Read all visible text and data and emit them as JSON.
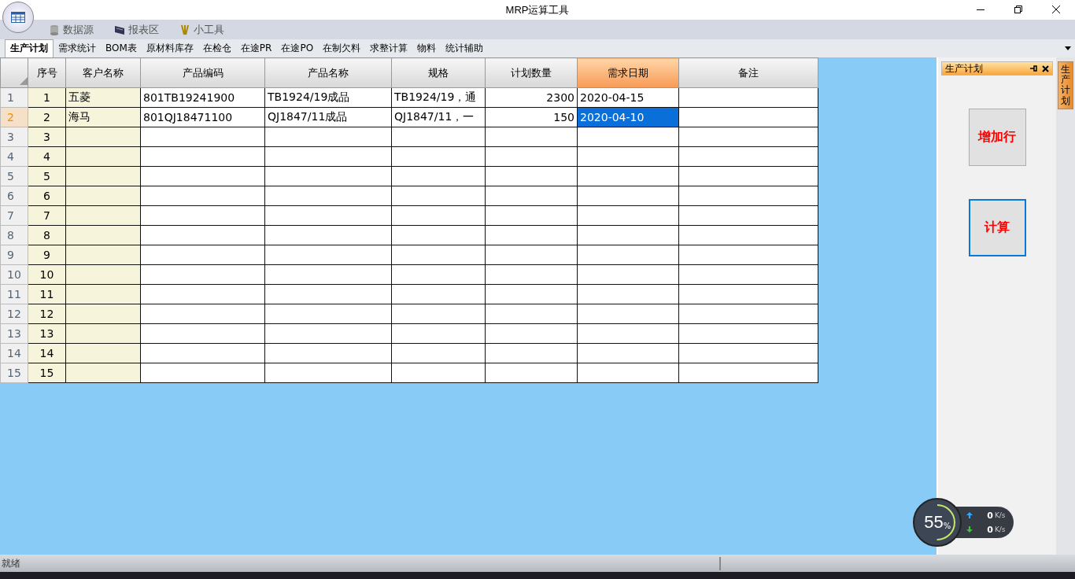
{
  "window": {
    "title": "MRP运算工具"
  },
  "ribbon_tabs": [
    {
      "label": "数据源",
      "kind": "database",
      "selected": false
    },
    {
      "label": "报表区",
      "kind": "chart",
      "selected": false
    },
    {
      "label": "小工具",
      "kind": "tools",
      "selected": false
    }
  ],
  "sheet_tabs": [
    {
      "label": "生产计划",
      "selected": true
    },
    {
      "label": "需求统计",
      "selected": false
    },
    {
      "label": "BOM表",
      "selected": false
    },
    {
      "label": "原材料库存",
      "selected": false
    },
    {
      "label": "在检仓",
      "selected": false
    },
    {
      "label": "在途PR",
      "selected": false
    },
    {
      "label": "在途PO",
      "selected": false
    },
    {
      "label": "在制欠料",
      "selected": false
    },
    {
      "label": "求整计算",
      "selected": false
    },
    {
      "label": "物料",
      "selected": false
    },
    {
      "label": "统计辅助",
      "selected": false
    }
  ],
  "table": {
    "columns": [
      {
        "label": "序号",
        "selected": false
      },
      {
        "label": "客户名称",
        "selected": false
      },
      {
        "label": "产品编码",
        "selected": false
      },
      {
        "label": "产品名称",
        "selected": false
      },
      {
        "label": "规格",
        "selected": false
      },
      {
        "label": "计划数量",
        "selected": false
      },
      {
        "label": "需求日期",
        "selected": true
      },
      {
        "label": "备注",
        "selected": false
      }
    ],
    "rows": [
      {
        "header": "1",
        "selected": false,
        "cells": [
          "1",
          "五菱",
          "801TB19241900",
          "TB1924/19成品",
          "TB1924/19，通",
          "2300",
          "2020-04-15",
          ""
        ]
      },
      {
        "header": "2",
        "selected": true,
        "cells": [
          "2",
          "海马",
          "801QJ18471100",
          "QJ1847/11成品",
          "QJ1847/11，一",
          "150",
          "2020-04-10",
          ""
        ]
      },
      {
        "header": "3",
        "selected": false,
        "cells": [
          "3",
          "",
          "",
          "",
          "",
          "",
          "",
          ""
        ]
      },
      {
        "header": "4",
        "selected": false,
        "cells": [
          "4",
          "",
          "",
          "",
          "",
          "",
          "",
          ""
        ]
      },
      {
        "header": "5",
        "selected": false,
        "cells": [
          "5",
          "",
          "",
          "",
          "",
          "",
          "",
          ""
        ]
      },
      {
        "header": "6",
        "selected": false,
        "cells": [
          "6",
          "",
          "",
          "",
          "",
          "",
          "",
          ""
        ]
      },
      {
        "header": "7",
        "selected": false,
        "cells": [
          "7",
          "",
          "",
          "",
          "",
          "",
          "",
          ""
        ]
      },
      {
        "header": "8",
        "selected": false,
        "cells": [
          "8",
          "",
          "",
          "",
          "",
          "",
          "",
          ""
        ]
      },
      {
        "header": "9",
        "selected": false,
        "cells": [
          "9",
          "",
          "",
          "",
          "",
          "",
          "",
          ""
        ]
      },
      {
        "header": "10",
        "selected": false,
        "cells": [
          "10",
          "",
          "",
          "",
          "",
          "",
          "",
          ""
        ]
      },
      {
        "header": "11",
        "selected": false,
        "cells": [
          "11",
          "",
          "",
          "",
          "",
          "",
          "",
          ""
        ]
      },
      {
        "header": "12",
        "selected": false,
        "cells": [
          "12",
          "",
          "",
          "",
          "",
          "",
          "",
          ""
        ]
      },
      {
        "header": "13",
        "selected": false,
        "cells": [
          "13",
          "",
          "",
          "",
          "",
          "",
          "",
          ""
        ]
      },
      {
        "header": "14",
        "selected": false,
        "cells": [
          "14",
          "",
          "",
          "",
          "",
          "",
          "",
          ""
        ]
      },
      {
        "header": "15",
        "selected": false,
        "cells": [
          "15",
          "",
          "",
          "",
          "",
          "",
          "",
          ""
        ]
      }
    ]
  },
  "side_panel": {
    "title": "生产计划",
    "buttons": [
      {
        "label": "增加行",
        "focused": false
      },
      {
        "label": "计算",
        "focused": true
      }
    ],
    "side_tab": "生产计划"
  },
  "net_widget": {
    "percent": "55",
    "percent_unit": "%",
    "upload": "0",
    "upload_unit": "K/s",
    "download": "0",
    "download_unit": "K/s"
  },
  "status_bar": {
    "text": "就绪"
  }
}
